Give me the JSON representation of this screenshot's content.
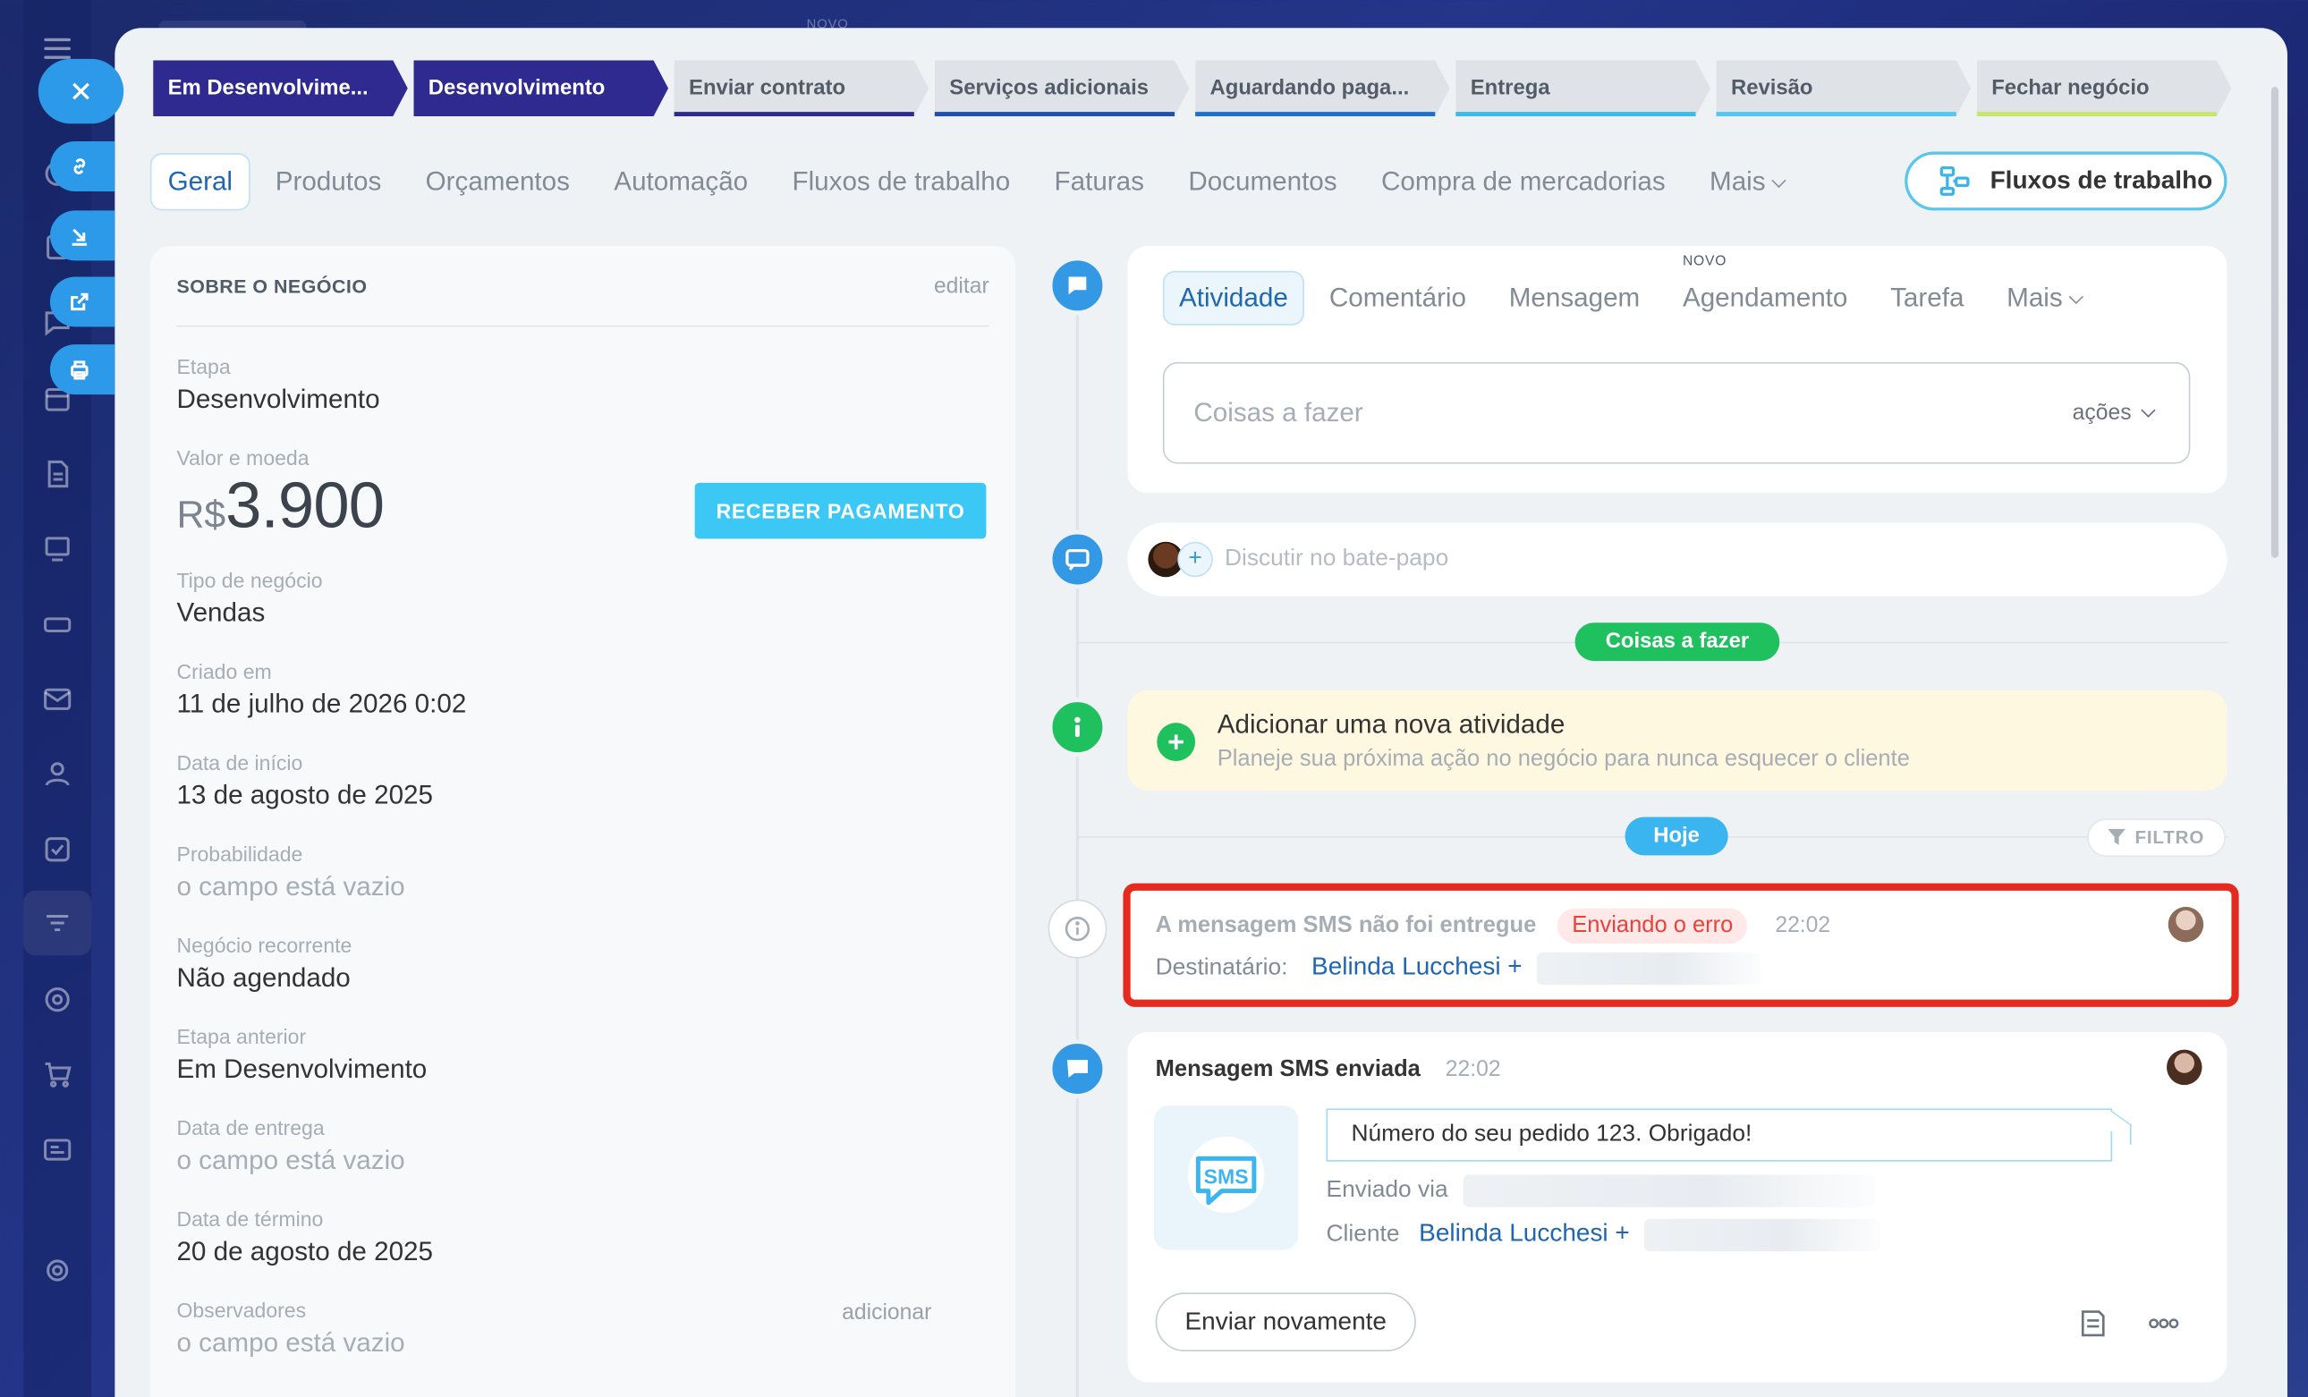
{
  "background": {
    "top_novo": "NOVO"
  },
  "stages": [
    {
      "label": "Em Desenvolvime...",
      "state": "done",
      "color": "#2f2a8f"
    },
    {
      "label": "Desenvolvimento",
      "state": "current",
      "color": "#2f2a8f"
    },
    {
      "label": "Enviar contrato",
      "state": "todo",
      "color": "#2f2a8f"
    },
    {
      "label": "Serviços adicionais",
      "state": "todo",
      "color": "#1f4fb0"
    },
    {
      "label": "Aguardando paga...",
      "state": "todo",
      "color": "#1f6fd0"
    },
    {
      "label": "Entrega",
      "state": "todo",
      "color": "#3bbbe8"
    },
    {
      "label": "Revisão",
      "state": "todo",
      "color": "#52c7f0"
    },
    {
      "label": "Fechar negócio",
      "state": "todo",
      "color": "#c8e66c"
    }
  ],
  "tabs": [
    {
      "label": "Geral",
      "active": true
    },
    {
      "label": "Produtos"
    },
    {
      "label": "Orçamentos"
    },
    {
      "label": "Automação"
    },
    {
      "label": "Fluxos de trabalho"
    },
    {
      "label": "Faturas"
    },
    {
      "label": "Documentos"
    },
    {
      "label": "Compra de mercadorias"
    },
    {
      "label": "Mais"
    }
  ],
  "workflows_button": "Fluxos de trabalho",
  "about": {
    "title": "SOBRE O NEGÓCIO",
    "edit": "editar",
    "stage_label": "Etapa",
    "stage_value": "Desenvolvimento",
    "amount_label": "Valor e moeda",
    "currency": "R$",
    "amount": "3.900",
    "pay_button": "RECEBER PAGAMENTO",
    "type_label": "Tipo de negócio",
    "type_value": "Vendas",
    "created_label": "Criado em",
    "created_value": "11 de julho de 2026 0:02",
    "start_label": "Data de início",
    "start_value": "13 de agosto de 2025",
    "prob_label": "Probabilidade",
    "prob_value": "o campo está vazio",
    "recurring_label": "Negócio recorrente",
    "recurring_value": "Não agendado",
    "prev_stage_label": "Etapa anterior",
    "prev_stage_value": "Em Desenvolvimento",
    "delivery_label": "Data de entrega",
    "delivery_value": "o campo está vazio",
    "end_label": "Data de término",
    "end_value": "20 de agosto de 2025",
    "observers_label": "Observadores",
    "observers_add": "adicionar",
    "observers_value": "o campo está vazio"
  },
  "activity": {
    "tabs": [
      "Atividade",
      "Comentário",
      "Mensagem",
      "Agendamento",
      "Tarefa",
      "Mais"
    ],
    "novo_badge": "NOVO",
    "todo_placeholder": "Coisas a fazer",
    "actions": "ações"
  },
  "chat": {
    "placeholder": "Discutir no bate-papo"
  },
  "todo_pill": "Coisas a fazer",
  "new_activity": {
    "title": "Adicionar uma nova atividade",
    "subtitle": "Planeje sua próxima ação no negócio para nunca esquecer o cliente"
  },
  "today_pill": "Hoje",
  "filter": "FILTRO",
  "sms_error": {
    "title": "A mensagem SMS não foi entregue",
    "badge": "Enviando o erro",
    "time": "22:02",
    "recipient_label": "Destinatário:",
    "recipient": "Belinda Lucchesi +"
  },
  "sms_sent": {
    "title": "Mensagem SMS enviada",
    "time": "22:02",
    "icon_text": "SMS",
    "message": "Número do seu pedido 123. Obrigado!",
    "sent_via_label": "Enviado via",
    "client_label": "Cliente",
    "client": "Belinda Lucchesi +",
    "resend": "Enviar novamente"
  },
  "colors": {
    "accent": "#2066b0",
    "pay": "#3bc8f5",
    "green": "#1fc15e",
    "error": "#e52a1f"
  }
}
